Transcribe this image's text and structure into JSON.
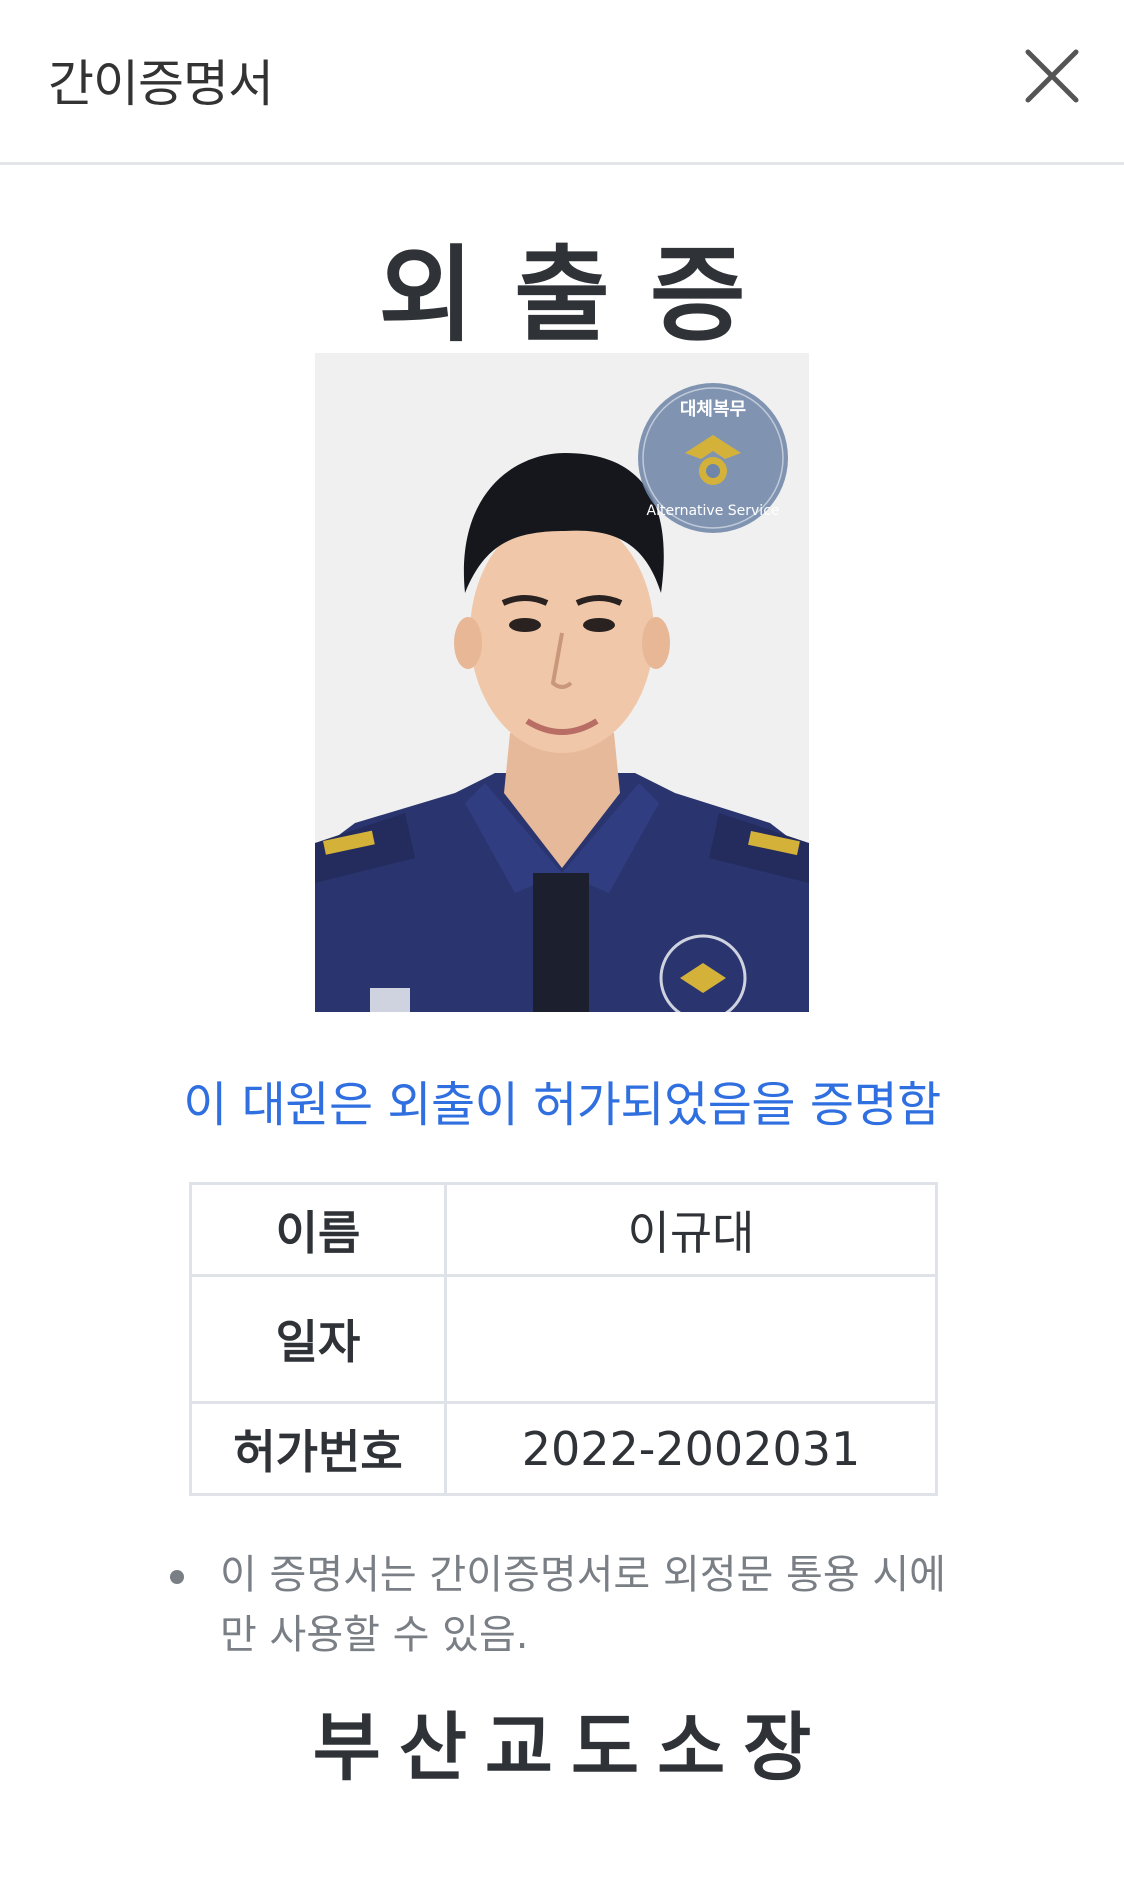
{
  "header": {
    "title": "간이증명서",
    "close_icon": "close-icon"
  },
  "card": {
    "title": "외출증",
    "photo_badge": {
      "top_text": "대체복무",
      "bottom_text": "Alternative Service"
    },
    "certify_text": "이 대원은 외출이 허가되었음을 증명함"
  },
  "info_table": {
    "rows": [
      {
        "label": "이름",
        "value": "이규대"
      },
      {
        "label": "일자",
        "value": ""
      },
      {
        "label": "허가번호",
        "value": "2022-2002031"
      }
    ]
  },
  "notice": {
    "text": "이 증명서는 간이증명서로 외정문 통용 시에만 사용할 수 있음."
  },
  "issuer": "부산교도소장",
  "colors": {
    "accent_blue": "#2f6fe0",
    "text_dark": "#2f3338",
    "text_gray": "#7a7f86",
    "border": "#dfe2e6",
    "uniform_navy": "#2a3570"
  }
}
